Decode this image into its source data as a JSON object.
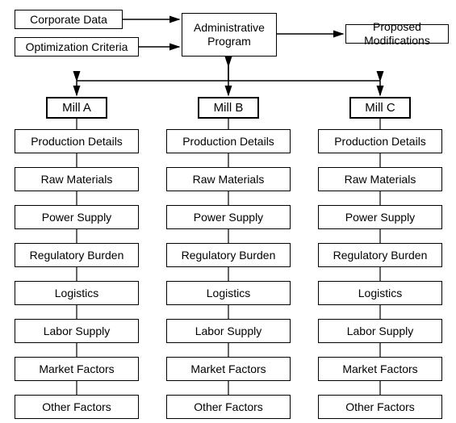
{
  "top": {
    "corporate_data": "Corporate Data",
    "optimization_criteria": "Optimization Criteria",
    "admin_program": "Administrative Program",
    "proposed_modifications": "Proposed Modifications"
  },
  "mills": {
    "a": {
      "title": "Mill A"
    },
    "b": {
      "title": "Mill B"
    },
    "c": {
      "title": "Mill C"
    }
  },
  "factors": {
    "production_details": "Production Details",
    "raw_materials": "Raw Materials",
    "power_supply": "Power Supply",
    "regulatory_burden": "Regulatory Burden",
    "logistics": "Logistics",
    "labor_supply": "Labor Supply",
    "market_factors": "Market Factors",
    "other_factors": "Other Factors"
  }
}
